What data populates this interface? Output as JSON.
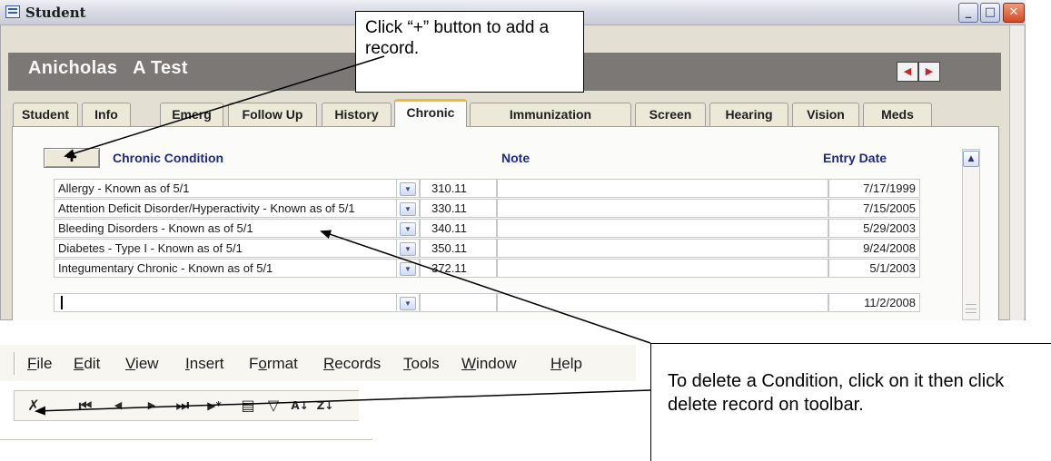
{
  "window": {
    "title": "Student",
    "controls": {
      "minimize": "_",
      "maximize": "□",
      "close": "✕"
    }
  },
  "header": {
    "student_name": "Anicholas   A Test",
    "nav_prev": "◀",
    "nav_next": "▶"
  },
  "tabs": [
    {
      "label": "Student",
      "active": false
    },
    {
      "label": "Info",
      "active": false
    },
    {
      "label": "Emerg",
      "active": false
    },
    {
      "label": "Follow Up",
      "active": false
    },
    {
      "label": "History",
      "active": false
    },
    {
      "label": "Chronic",
      "active": true
    },
    {
      "label": "Immunization",
      "active": false
    },
    {
      "label": "Screen",
      "active": false
    },
    {
      "label": "Hearing",
      "active": false
    },
    {
      "label": "Vision",
      "active": false
    },
    {
      "label": "Meds",
      "active": false
    }
  ],
  "chronic": {
    "add_button": "✚",
    "columns": {
      "condition": "Chronic Condition",
      "note": "Note",
      "entry_date": "Entry Date"
    },
    "rows": [
      {
        "condition": "Allergy - Known as of 5/1",
        "code": "310.11",
        "note": "",
        "entry_date": "7/17/1999"
      },
      {
        "condition": "Attention Deficit Disorder/Hyperactivity - Known as of 5/1",
        "code": "330.11",
        "note": "",
        "entry_date": "7/15/2005"
      },
      {
        "condition": "Bleeding Disorders - Known as of 5/1",
        "code": "340.11",
        "note": "",
        "entry_date": "5/29/2003"
      },
      {
        "condition": "Diabetes - Type I - Known as of 5/1",
        "code": "350.11",
        "note": "",
        "entry_date": "9/24/2008"
      },
      {
        "condition": "Integumentary Chronic - Known as of 5/1",
        "code": "372.11",
        "note": "",
        "entry_date": "5/1/2003"
      },
      {
        "condition": "",
        "code": "",
        "note": "",
        "entry_date": "11/2/2008"
      }
    ],
    "dropdown_glyph": "▼",
    "scroll_up": "▲"
  },
  "menubar": {
    "items": [
      {
        "label": "File",
        "key": "F",
        "rest": "ile"
      },
      {
        "label": "Edit",
        "key": "E",
        "rest": "dit"
      },
      {
        "label": "View",
        "key": "V",
        "rest": "iew"
      },
      {
        "label": "Insert",
        "key": "I",
        "rest": "nsert"
      },
      {
        "label": "Format",
        "key": "o",
        "pre": "F",
        "rest": "rmat"
      },
      {
        "label": "Records",
        "key": "R",
        "rest": "ecords"
      },
      {
        "label": "Tools",
        "key": "T",
        "rest": "ools"
      },
      {
        "label": "Window",
        "key": "W",
        "rest": "indow"
      },
      {
        "label": "Help",
        "key": "H",
        "rest": "elp"
      }
    ]
  },
  "toolbar": {
    "delete_record": "✗",
    "first_record": "⏮",
    "prev_record": "◀",
    "next_record": "▶",
    "last_record": "⏭",
    "new_record": "▶*",
    "filter_by_form": "▤",
    "filter": "▽",
    "sort_asc": "A↓",
    "sort_desc": "Z↓"
  },
  "callouts": {
    "add": "Click “+” button to add a record.",
    "delete": "To delete a Condition, click on it then click delete record on toolbar."
  }
}
